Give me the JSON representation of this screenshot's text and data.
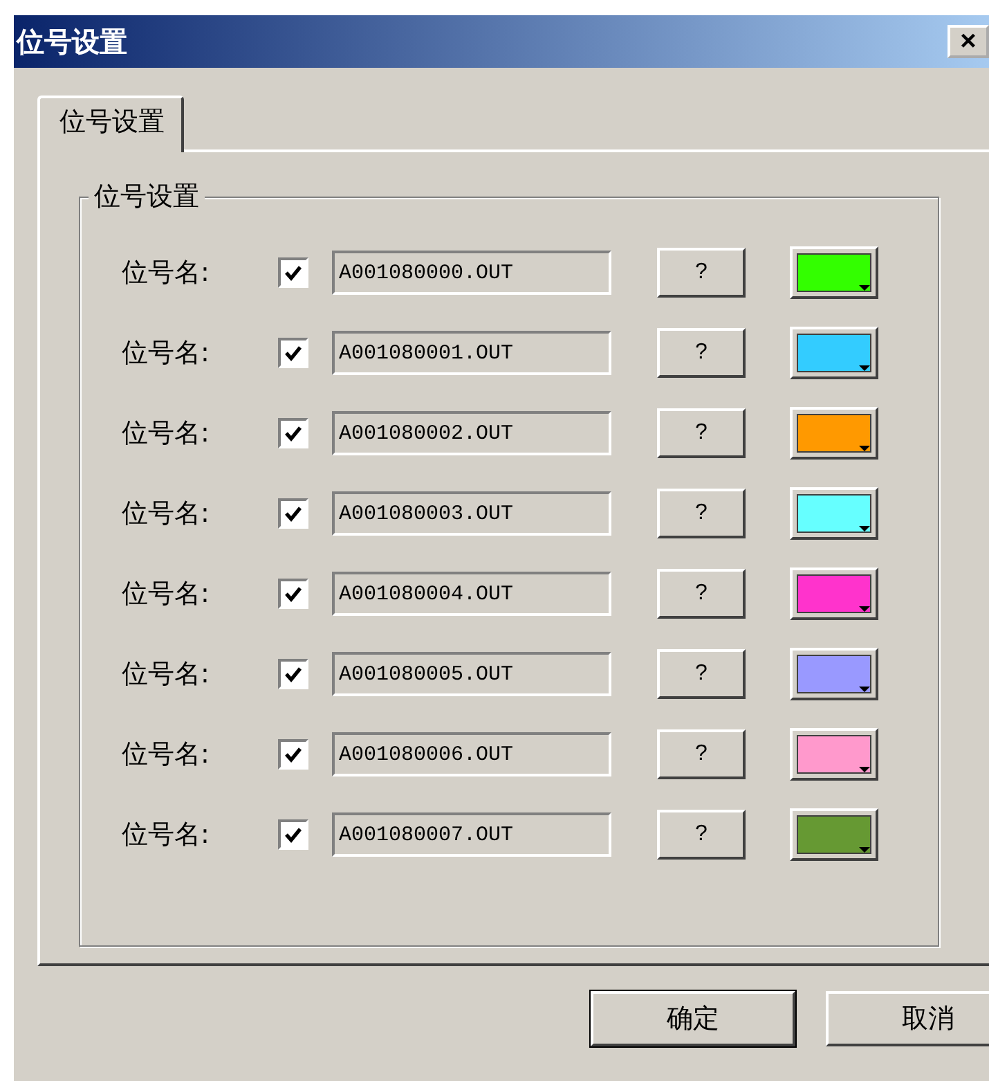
{
  "window": {
    "title": "位号设置",
    "close": "×"
  },
  "tabs": [
    {
      "label": "位号设置",
      "selected": true
    }
  ],
  "group": {
    "title": "位号设置"
  },
  "rows": [
    {
      "label": "位号名:",
      "checked": true,
      "value": "A001080000.OUT",
      "browse": "?",
      "color": "#33ff00"
    },
    {
      "label": "位号名:",
      "checked": true,
      "value": "A001080001.OUT",
      "browse": "?",
      "color": "#33ccff"
    },
    {
      "label": "位号名:",
      "checked": true,
      "value": "A001080002.OUT",
      "browse": "?",
      "color": "#ff9900"
    },
    {
      "label": "位号名:",
      "checked": true,
      "value": "A001080003.OUT",
      "browse": "?",
      "color": "#66ffff"
    },
    {
      "label": "位号名:",
      "checked": true,
      "value": "A001080004.OUT",
      "browse": "?",
      "color": "#ff33cc"
    },
    {
      "label": "位号名:",
      "checked": true,
      "value": "A001080005.OUT",
      "browse": "?",
      "color": "#9999ff"
    },
    {
      "label": "位号名:",
      "checked": true,
      "value": "A001080006.OUT",
      "browse": "?",
      "color": "#ff99cc"
    },
    {
      "label": "位号名:",
      "checked": true,
      "value": "A001080007.OUT",
      "browse": "?",
      "color": "#669933"
    }
  ],
  "buttons": [
    "确定",
    "取消"
  ]
}
